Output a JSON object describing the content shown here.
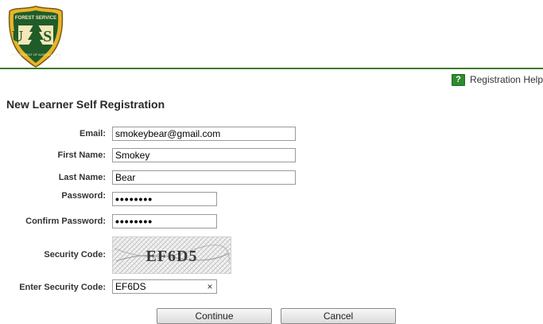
{
  "logo": {
    "top_text": "FOREST SERVICE",
    "bottom_text": "DEPARTMENT OF AGRICULTURE",
    "letters": "U S"
  },
  "help": {
    "label": "Registration Help",
    "icon": "?"
  },
  "page_title": "New Learner Self Registration",
  "form": {
    "email": {
      "label": "Email:",
      "value": "smokeybear@gmail.com"
    },
    "first_name": {
      "label": "First Name:",
      "value": "Smokey"
    },
    "last_name": {
      "label": "Last Name:",
      "value": "Bear"
    },
    "password": {
      "label": "Password:",
      "value": "••••••••"
    },
    "confirm_password": {
      "label": "Confirm Password:",
      "value": "••••••••"
    },
    "security_code": {
      "label": "Security Code:",
      "captcha_text": "EF6D5"
    },
    "enter_security_code": {
      "label": "Enter Security Code:",
      "value": "EF6DS",
      "clear": "×"
    }
  },
  "buttons": {
    "continue": "Continue",
    "cancel": "Cancel"
  },
  "colors": {
    "header_rule": "#3b7a2a",
    "help_icon": "#2e8b2e",
    "logo_green": "#1f5c2a",
    "logo_gold": "#e8b52a"
  }
}
